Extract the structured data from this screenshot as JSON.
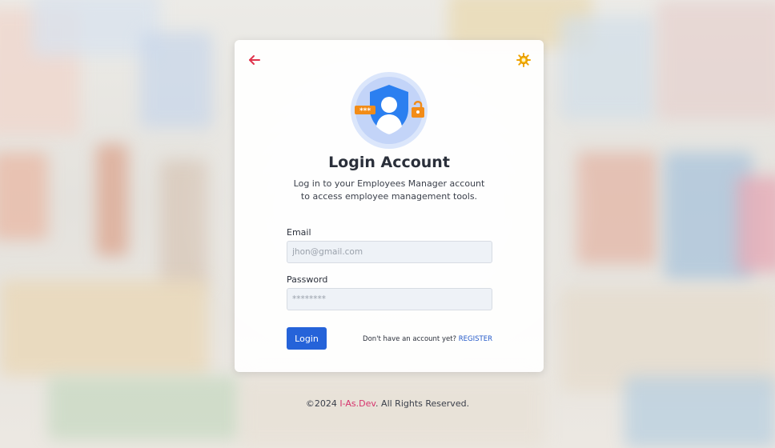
{
  "colors": {
    "accent": "#2563d9",
    "back_icon": "#e0344c",
    "theme_icon": "#f0a500",
    "brand_link": "#d6336c",
    "register_link": "#2459c9"
  },
  "card": {
    "back_icon": "arrow-left-icon",
    "theme_icon": "sun-icon",
    "logo_icon": "user-shield-lock-icon",
    "title": "Login Account",
    "subtitle": "Log in to your Employees Manager account to access employee management tools."
  },
  "form": {
    "email_label": "Email",
    "email_placeholder": "jhon@gmail.com",
    "email_value": "",
    "password_label": "Password",
    "password_placeholder": "********",
    "password_value": "",
    "login_label": "Login",
    "register_prompt": "Don't have an account yet?",
    "register_label": "REGISTER"
  },
  "footer": {
    "copyright": "©2024",
    "brand": "I-As.Dev",
    "rights": ". All Rights Reserved."
  }
}
